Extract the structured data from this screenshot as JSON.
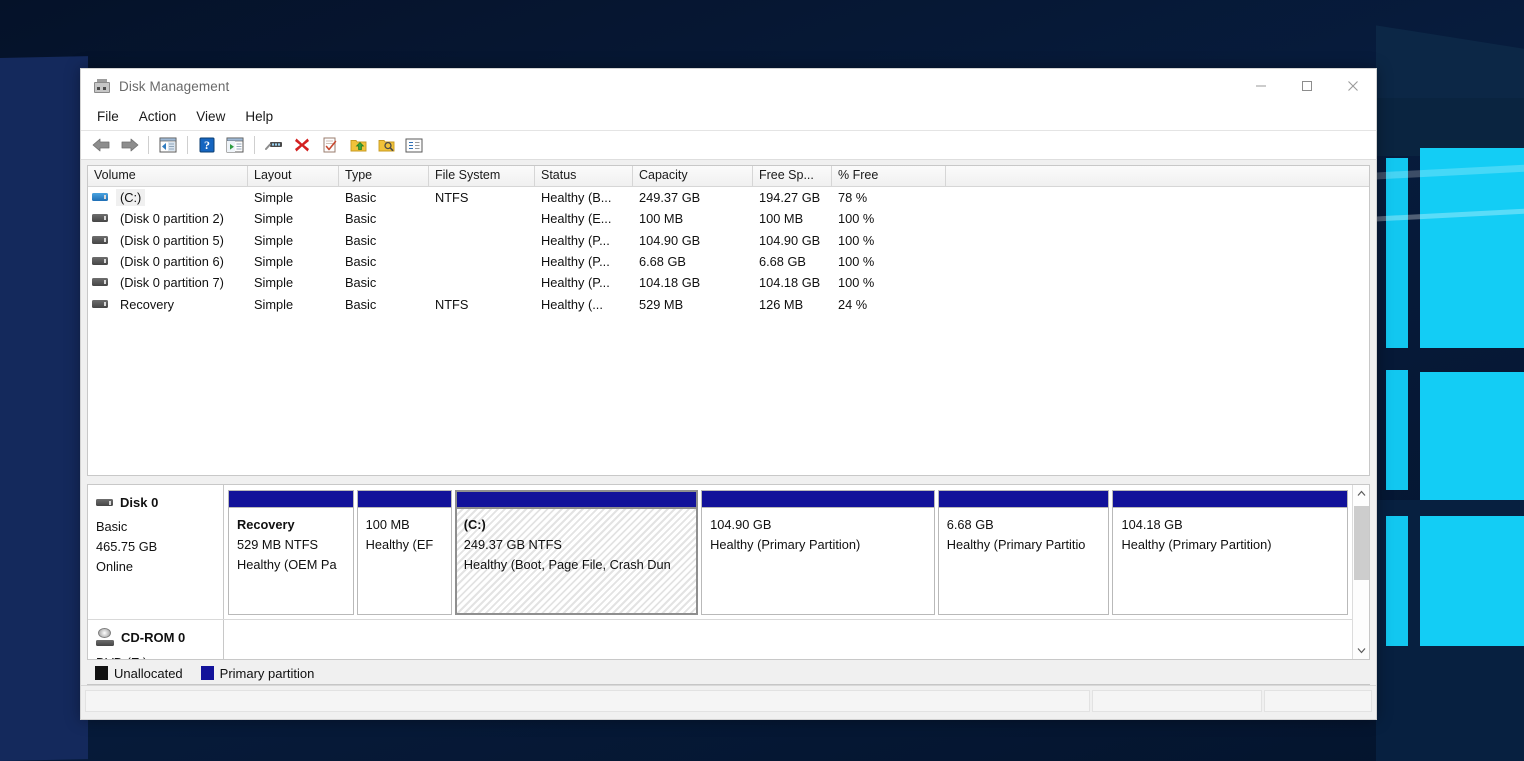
{
  "window": {
    "title": "Disk Management",
    "icon": "disk-management-icon",
    "controls": {
      "minimize": "minimize-icon",
      "maximize": "maximize-icon",
      "close": "close-icon"
    }
  },
  "menubar": {
    "items": [
      "File",
      "Action",
      "View",
      "Help"
    ]
  },
  "toolbar": {
    "buttons": [
      {
        "name": "back-arrow-icon",
        "tip": "Back"
      },
      {
        "name": "forward-arrow-icon",
        "tip": "Forward"
      },
      {
        "name": "show-console-tree-icon",
        "tip": "Show/Hide Console Tree"
      },
      {
        "name": "help-icon",
        "tip": "Help"
      },
      {
        "name": "show-action-pane-icon",
        "tip": "Show/Hide Action Pane"
      },
      {
        "name": "rescan-disks-icon",
        "tip": "Rescan Disks"
      },
      {
        "name": "delete-icon",
        "tip": "Delete"
      },
      {
        "name": "properties-icon",
        "tip": "Properties"
      },
      {
        "name": "export-list-icon",
        "tip": "Export List"
      },
      {
        "name": "search-icon",
        "tip": "Find"
      },
      {
        "name": "detail-view-icon",
        "tip": "Detail View"
      }
    ]
  },
  "volume_list": {
    "columns": [
      {
        "label": "Volume",
        "width": 160
      },
      {
        "label": "Layout",
        "width": 91
      },
      {
        "label": "Type",
        "width": 90
      },
      {
        "label": "File System",
        "width": 106
      },
      {
        "label": "Status",
        "width": 98
      },
      {
        "label": "Capacity",
        "width": 120
      },
      {
        "label": "Free Sp...",
        "width": 79
      },
      {
        "label": "% Free",
        "width": 114
      },
      {
        "label": "",
        "width": 0
      }
    ],
    "rows": [
      {
        "volume": "(C:)",
        "icon": "drive-icon-selected",
        "selected": true,
        "layout": "Simple",
        "type": "Basic",
        "file_system": "NTFS",
        "status": "Healthy (B...",
        "capacity": "249.37 GB",
        "free_space": "194.27 GB",
        "percent_free": "78 %"
      },
      {
        "volume": "(Disk 0 partition 2)",
        "icon": "drive-icon",
        "selected": false,
        "layout": "Simple",
        "type": "Basic",
        "file_system": "",
        "status": "Healthy (E...",
        "capacity": "100 MB",
        "free_space": "100 MB",
        "percent_free": "100 %"
      },
      {
        "volume": "(Disk 0 partition 5)",
        "icon": "drive-icon",
        "selected": false,
        "layout": "Simple",
        "type": "Basic",
        "file_system": "",
        "status": "Healthy (P...",
        "capacity": "104.90 GB",
        "free_space": "104.90 GB",
        "percent_free": "100 %"
      },
      {
        "volume": "(Disk 0 partition 6)",
        "icon": "drive-icon",
        "selected": false,
        "layout": "Simple",
        "type": "Basic",
        "file_system": "",
        "status": "Healthy (P...",
        "capacity": "6.68 GB",
        "free_space": "6.68 GB",
        "percent_free": "100 %"
      },
      {
        "volume": "(Disk 0 partition 7)",
        "icon": "drive-icon",
        "selected": false,
        "layout": "Simple",
        "type": "Basic",
        "file_system": "",
        "status": "Healthy (P...",
        "capacity": "104.18 GB",
        "free_space": "104.18 GB",
        "percent_free": "100 %"
      },
      {
        "volume": "Recovery",
        "icon": "drive-icon",
        "selected": false,
        "layout": "Simple",
        "type": "Basic",
        "file_system": "NTFS",
        "status": "Healthy (...",
        "capacity": "529 MB",
        "free_space": "126 MB",
        "percent_free": "24 %"
      }
    ]
  },
  "graphical_view": {
    "disks": [
      {
        "name": "Disk 0",
        "icon": "hdd-icon",
        "type": "Basic",
        "size": "465.75 GB",
        "state": "Online",
        "partitions": [
          {
            "label": "Recovery",
            "size_fs": "529 MB NTFS",
            "status": "Healthy (OEM Pa",
            "selected": false,
            "flex": 128
          },
          {
            "label": "",
            "size_fs": "100 MB",
            "status": "Healthy (EF",
            "selected": false,
            "flex": 97
          },
          {
            "label": "(C:)",
            "size_fs": "249.37 GB NTFS",
            "status": "Healthy (Boot, Page File, Crash Dun",
            "selected": true,
            "flex": 248
          },
          {
            "label": "",
            "size_fs": "104.90 GB",
            "status": "Healthy (Primary Partition)",
            "selected": false,
            "flex": 238
          },
          {
            "label": "",
            "size_fs": "6.68 GB",
            "status": "Healthy (Primary Partitio",
            "selected": false,
            "flex": 175
          },
          {
            "label": "",
            "size_fs": "104.18 GB",
            "status": "Healthy (Primary Partition)",
            "selected": false,
            "flex": 240
          }
        ]
      },
      {
        "name": "CD-ROM 0",
        "icon": "cd-rom-icon",
        "type": "DVD (E:)",
        "size": "",
        "state": "",
        "partitions": []
      }
    ],
    "scrollbar": {
      "up_arrow": "chevron-up-icon",
      "down_arrow": "chevron-down-icon"
    }
  },
  "legend": {
    "items": [
      {
        "label": "Unallocated",
        "color": "#111111",
        "name": "legend-unallocated"
      },
      {
        "label": "Primary partition",
        "color": "#12129a",
        "name": "legend-primary-partition"
      }
    ]
  },
  "statusbar": {
    "panes": [
      "",
      "",
      ""
    ]
  },
  "colors": {
    "partition_bar": "#12129a",
    "window_bg": "#f0f0f0",
    "title_text": "#6a6a6a"
  }
}
